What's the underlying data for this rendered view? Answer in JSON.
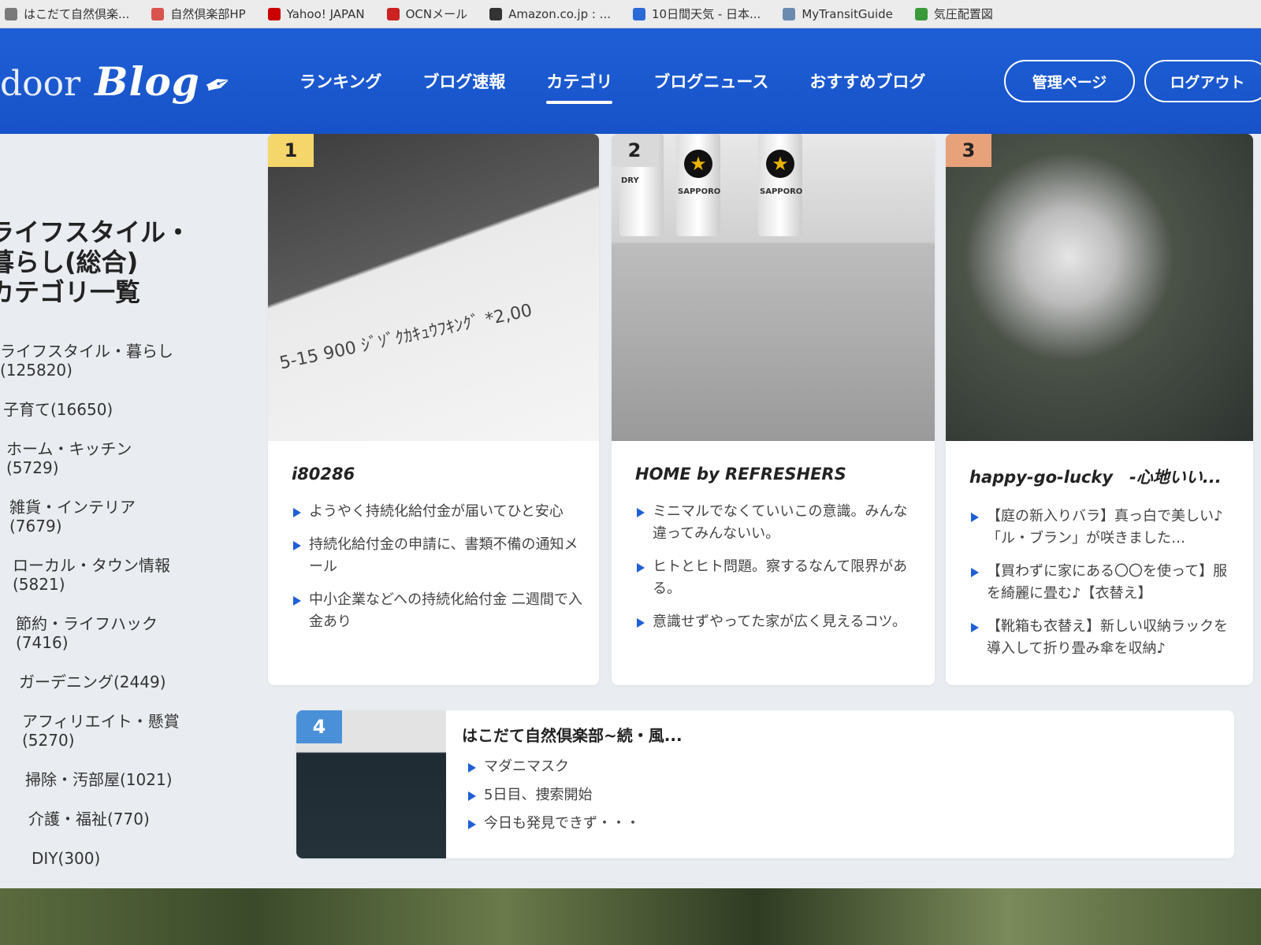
{
  "bookmarks": [
    {
      "label": "はこだて自然倶楽...",
      "color": "#7a7a7a"
    },
    {
      "label": "自然倶楽部HP",
      "color": "#d9534f"
    },
    {
      "label": "Yahoo! JAPAN",
      "color": "#cc0000"
    },
    {
      "label": "OCNメール",
      "color": "#cc2222"
    },
    {
      "label": "Amazon.co.jp : ...",
      "color": "#333333"
    },
    {
      "label": "10日間天気 - 日本...",
      "color": "#2a6ad6"
    },
    {
      "label": "MyTransitGuide",
      "color": "#6a8ab0"
    },
    {
      "label": "気圧配置図",
      "color": "#3a9a3a"
    }
  ],
  "header": {
    "logo_door": "door",
    "logo_blog": "Blog",
    "nav": [
      "ランキング",
      "ブログ速報",
      "カテゴリ",
      "ブログニュース",
      "おすすめブログ"
    ],
    "active_nav": "カテゴリ",
    "admin_button": "管理ページ",
    "logout_button": "ログアウト"
  },
  "sidebar": {
    "title_lines": [
      "ライフスタイル・",
      "暮らし(総合)",
      "カテゴリ一覧"
    ],
    "categories": [
      {
        "name": "ライフスタイル・暮らし",
        "count": "(125820)"
      },
      {
        "name": "子育て(16650)",
        "count": ""
      },
      {
        "name": "ホーム・キッチン",
        "count": "(5729)"
      },
      {
        "name": "雑貨・インテリア",
        "count": "(7679)"
      },
      {
        "name": "ローカル・タウン情報",
        "count": "(5821)"
      },
      {
        "name": "節約・ライフハック",
        "count": "(7416)"
      },
      {
        "name": "ガーデニング(2449)",
        "count": ""
      },
      {
        "name": "アフィリエイト・懸賞",
        "count": "(5270)"
      },
      {
        "name": "掃除・汚部屋(1021)",
        "count": ""
      },
      {
        "name": "介護・福祉(770)",
        "count": ""
      },
      {
        "name": "DIY(300)",
        "count": ""
      }
    ]
  },
  "cards": [
    {
      "rank": "1",
      "rank_color": "#f5d66b",
      "title": "i80286",
      "receipt_text": "5-15   900   ｼﾞｿﾞｸｶｷｭｳﾌｷﾝｸﾞ   *2,00",
      "posts": [
        "ようやく持続化給付金が届いてひと安心",
        "持続化給付金の申請に、書類不備の通知メール",
        "中小企業などへの持続化給付金 二週間で入金あり"
      ]
    },
    {
      "rank": "2",
      "rank_color": "#d9d9d9",
      "title": "HOME by REFRESHERS",
      "can_labels": [
        "DRY",
        "SAPPORO",
        "SAPPORO"
      ],
      "posts": [
        "ミニマルでなくていいこの意識。みんな違ってみんないい。",
        "ヒトとヒト問題。察するなんて限界がある。",
        "意識せずやってた家が広く見えるコツ。"
      ]
    },
    {
      "rank": "3",
      "rank_color": "#e8a27a",
      "title": "happy-go-lucky　-心地いい...",
      "posts": [
        "【庭の新入りバラ】真っ白で美しい♪「ル・ブラン」が咲きました…",
        "【買わずに家にある〇〇を使って】服を綺麗に畳む♪【衣替え】",
        "【靴箱も衣替え】新しい収納ラックを導入して折り畳み傘を収納♪"
      ]
    },
    {
      "rank": "4",
      "rank_color": "#4a90d9",
      "title": "はこだて自然倶楽部~続・風...",
      "posts": [
        "マダニマスク",
        "5日目、捜索開始",
        "今日も発見できず・・・"
      ]
    }
  ]
}
